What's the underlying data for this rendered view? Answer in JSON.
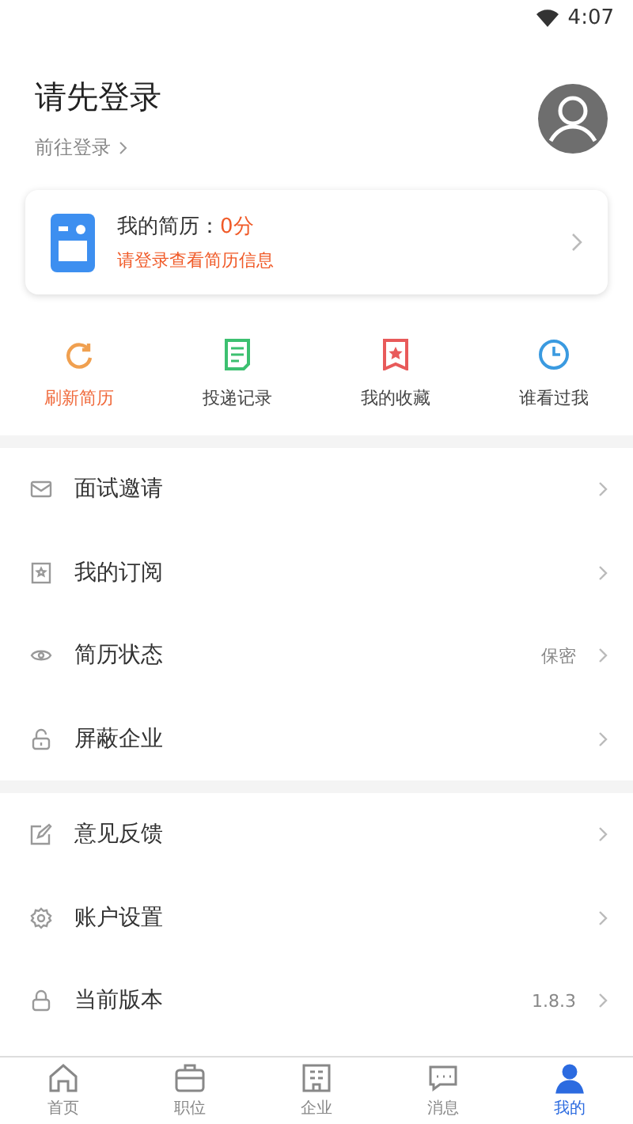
{
  "status_bar": {
    "time": "4:07"
  },
  "header": {
    "title": "请先登录",
    "login_link": "前往登录"
  },
  "resume_card": {
    "label": "我的简历：",
    "score": "0分",
    "hint": "请登录查看简历信息"
  },
  "quick_actions": [
    {
      "kind": "refresh",
      "label": "刷新简历",
      "color": "#f0a050",
      "highlighted": true
    },
    {
      "kind": "document",
      "label": "投递记录",
      "color": "#3cc070",
      "highlighted": false
    },
    {
      "kind": "favorite",
      "label": "我的收藏",
      "color": "#e85a5a",
      "highlighted": false
    },
    {
      "kind": "clock",
      "label": "谁看过我",
      "color": "#3a9ae0",
      "highlighted": false
    }
  ],
  "menu_groups": [
    [
      {
        "kind": "mail",
        "label": "面试邀请"
      },
      {
        "kind": "bookmark",
        "label": "我的订阅"
      },
      {
        "kind": "eye",
        "label": "简历状态",
        "value": "保密"
      },
      {
        "kind": "unlock",
        "label": "屏蔽企业"
      }
    ],
    [
      {
        "kind": "edit",
        "label": "意见反馈"
      },
      {
        "kind": "gear",
        "label": "账户设置"
      },
      {
        "kind": "lock",
        "label": "当前版本",
        "value": "1.8.3"
      }
    ]
  ],
  "tabs": [
    {
      "kind": "home",
      "label": "首页",
      "selected": false
    },
    {
      "kind": "briefcase",
      "label": "职位",
      "selected": false
    },
    {
      "kind": "building",
      "label": "企业",
      "selected": false
    },
    {
      "kind": "message",
      "label": "消息",
      "selected": false
    },
    {
      "kind": "person",
      "label": "我的",
      "selected": true
    }
  ]
}
